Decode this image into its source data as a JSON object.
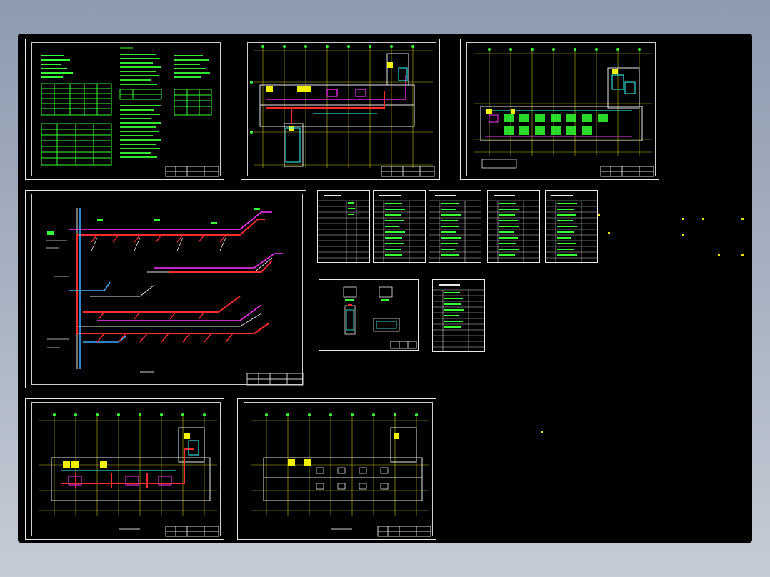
{
  "viewer": {
    "background": "#000000",
    "frame_color": "#e8e8e8"
  },
  "sheets": [
    {
      "id": "design-notes",
      "kind": "notes-and-tables"
    },
    {
      "id": "floor-plan-upper",
      "kind": "floor-plan"
    },
    {
      "id": "floor-plan-right",
      "kind": "floor-plan"
    },
    {
      "id": "pipe-system-diagram",
      "kind": "isometric-diagram"
    },
    {
      "id": "floor-plan-lower-left",
      "kind": "floor-plan"
    },
    {
      "id": "floor-plan-lower-mid",
      "kind": "floor-plan"
    }
  ],
  "tables": [
    {
      "id": "schedule-1"
    },
    {
      "id": "schedule-2"
    },
    {
      "id": "schedule-3"
    },
    {
      "id": "schedule-4"
    },
    {
      "id": "schedule-5"
    },
    {
      "id": "detail-sheet"
    },
    {
      "id": "schedule-6"
    }
  ],
  "colors": {
    "text_green": "#33ff33",
    "pipe_red": "#ff2a2a",
    "pipe_magenta": "#ff33ff",
    "pipe_blue": "#3fa9ff",
    "grid_yellow": "#f0f000",
    "cyan": "#33ffff",
    "white": "#e6e6e6"
  }
}
